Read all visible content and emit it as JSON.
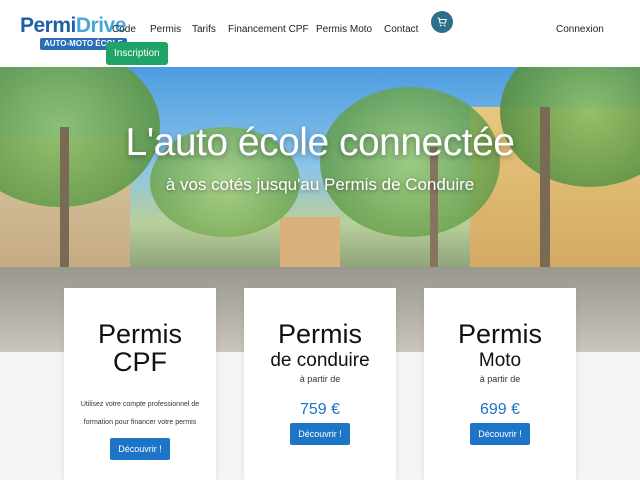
{
  "logo": {
    "name_part1": "Permi",
    "name_part2": "Drive",
    "tagline": "AUTO-MOTO ÉCOLE"
  },
  "nav": {
    "items": [
      {
        "label": "Code"
      },
      {
        "label": "Permis"
      },
      {
        "label": "Tarifs"
      },
      {
        "label": "Financement CPF"
      },
      {
        "label": "Permis Moto"
      },
      {
        "label": "Contact"
      }
    ],
    "cart_icon": "cart-icon",
    "login_label": "Connexion",
    "signup_label": "Inscription"
  },
  "hero": {
    "title": "L'auto école connectée",
    "subtitle": "à vos cotés jusqu'au Permis de Conduire"
  },
  "cards": [
    {
      "title_line1": "Permis",
      "title_line2": "CPF",
      "description": "Utilisez votre compte professionnel de formation pour financer votre permis",
      "button": "Découvrir !"
    },
    {
      "title_line1": "Permis",
      "title_line2": "de conduire",
      "price_prefix": "à partir de",
      "price": "759 €",
      "button": "Découvrir !"
    },
    {
      "title_line1": "Permis",
      "title_line2": "Moto",
      "price_prefix": "à partir de",
      "price": "699 €",
      "button": "Découvrir !"
    }
  ],
  "colors": {
    "brand_dark": "#1f5fa8",
    "brand_light": "#4aa8d8",
    "signup_green": "#1fa366",
    "button_blue": "#1e74c6",
    "cart_teal": "#2b6f88"
  }
}
